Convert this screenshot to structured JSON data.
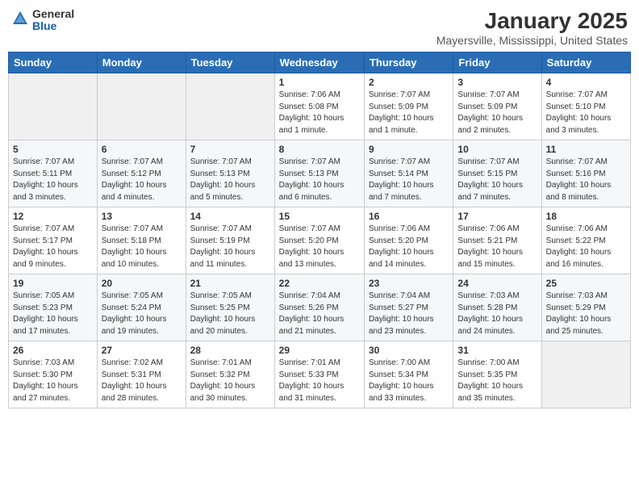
{
  "header": {
    "logo_general": "General",
    "logo_blue": "Blue",
    "month_year": "January 2025",
    "location": "Mayersville, Mississippi, United States"
  },
  "days_of_week": [
    "Sunday",
    "Monday",
    "Tuesday",
    "Wednesday",
    "Thursday",
    "Friday",
    "Saturday"
  ],
  "weeks": [
    [
      {
        "day": "",
        "info": ""
      },
      {
        "day": "",
        "info": ""
      },
      {
        "day": "",
        "info": ""
      },
      {
        "day": "1",
        "info": "Sunrise: 7:06 AM\nSunset: 5:08 PM\nDaylight: 10 hours\nand 1 minute."
      },
      {
        "day": "2",
        "info": "Sunrise: 7:07 AM\nSunset: 5:09 PM\nDaylight: 10 hours\nand 1 minute."
      },
      {
        "day": "3",
        "info": "Sunrise: 7:07 AM\nSunset: 5:09 PM\nDaylight: 10 hours\nand 2 minutes."
      },
      {
        "day": "4",
        "info": "Sunrise: 7:07 AM\nSunset: 5:10 PM\nDaylight: 10 hours\nand 3 minutes."
      }
    ],
    [
      {
        "day": "5",
        "info": "Sunrise: 7:07 AM\nSunset: 5:11 PM\nDaylight: 10 hours\nand 3 minutes."
      },
      {
        "day": "6",
        "info": "Sunrise: 7:07 AM\nSunset: 5:12 PM\nDaylight: 10 hours\nand 4 minutes."
      },
      {
        "day": "7",
        "info": "Sunrise: 7:07 AM\nSunset: 5:13 PM\nDaylight: 10 hours\nand 5 minutes."
      },
      {
        "day": "8",
        "info": "Sunrise: 7:07 AM\nSunset: 5:13 PM\nDaylight: 10 hours\nand 6 minutes."
      },
      {
        "day": "9",
        "info": "Sunrise: 7:07 AM\nSunset: 5:14 PM\nDaylight: 10 hours\nand 7 minutes."
      },
      {
        "day": "10",
        "info": "Sunrise: 7:07 AM\nSunset: 5:15 PM\nDaylight: 10 hours\nand 7 minutes."
      },
      {
        "day": "11",
        "info": "Sunrise: 7:07 AM\nSunset: 5:16 PM\nDaylight: 10 hours\nand 8 minutes."
      }
    ],
    [
      {
        "day": "12",
        "info": "Sunrise: 7:07 AM\nSunset: 5:17 PM\nDaylight: 10 hours\nand 9 minutes."
      },
      {
        "day": "13",
        "info": "Sunrise: 7:07 AM\nSunset: 5:18 PM\nDaylight: 10 hours\nand 10 minutes."
      },
      {
        "day": "14",
        "info": "Sunrise: 7:07 AM\nSunset: 5:19 PM\nDaylight: 10 hours\nand 11 minutes."
      },
      {
        "day": "15",
        "info": "Sunrise: 7:07 AM\nSunset: 5:20 PM\nDaylight: 10 hours\nand 13 minutes."
      },
      {
        "day": "16",
        "info": "Sunrise: 7:06 AM\nSunset: 5:20 PM\nDaylight: 10 hours\nand 14 minutes."
      },
      {
        "day": "17",
        "info": "Sunrise: 7:06 AM\nSunset: 5:21 PM\nDaylight: 10 hours\nand 15 minutes."
      },
      {
        "day": "18",
        "info": "Sunrise: 7:06 AM\nSunset: 5:22 PM\nDaylight: 10 hours\nand 16 minutes."
      }
    ],
    [
      {
        "day": "19",
        "info": "Sunrise: 7:05 AM\nSunset: 5:23 PM\nDaylight: 10 hours\nand 17 minutes."
      },
      {
        "day": "20",
        "info": "Sunrise: 7:05 AM\nSunset: 5:24 PM\nDaylight: 10 hours\nand 19 minutes."
      },
      {
        "day": "21",
        "info": "Sunrise: 7:05 AM\nSunset: 5:25 PM\nDaylight: 10 hours\nand 20 minutes."
      },
      {
        "day": "22",
        "info": "Sunrise: 7:04 AM\nSunset: 5:26 PM\nDaylight: 10 hours\nand 21 minutes."
      },
      {
        "day": "23",
        "info": "Sunrise: 7:04 AM\nSunset: 5:27 PM\nDaylight: 10 hours\nand 23 minutes."
      },
      {
        "day": "24",
        "info": "Sunrise: 7:03 AM\nSunset: 5:28 PM\nDaylight: 10 hours\nand 24 minutes."
      },
      {
        "day": "25",
        "info": "Sunrise: 7:03 AM\nSunset: 5:29 PM\nDaylight: 10 hours\nand 25 minutes."
      }
    ],
    [
      {
        "day": "26",
        "info": "Sunrise: 7:03 AM\nSunset: 5:30 PM\nDaylight: 10 hours\nand 27 minutes."
      },
      {
        "day": "27",
        "info": "Sunrise: 7:02 AM\nSunset: 5:31 PM\nDaylight: 10 hours\nand 28 minutes."
      },
      {
        "day": "28",
        "info": "Sunrise: 7:01 AM\nSunset: 5:32 PM\nDaylight: 10 hours\nand 30 minutes."
      },
      {
        "day": "29",
        "info": "Sunrise: 7:01 AM\nSunset: 5:33 PM\nDaylight: 10 hours\nand 31 minutes."
      },
      {
        "day": "30",
        "info": "Sunrise: 7:00 AM\nSunset: 5:34 PM\nDaylight: 10 hours\nand 33 minutes."
      },
      {
        "day": "31",
        "info": "Sunrise: 7:00 AM\nSunset: 5:35 PM\nDaylight: 10 hours\nand 35 minutes."
      },
      {
        "day": "",
        "info": ""
      }
    ]
  ]
}
